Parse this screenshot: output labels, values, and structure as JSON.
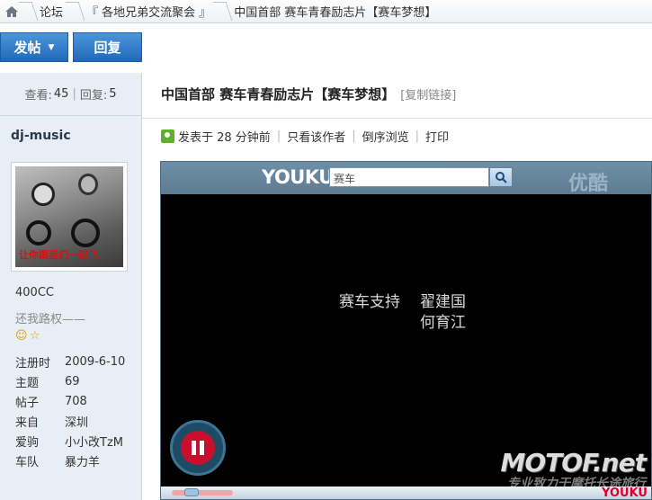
{
  "breadcrumb": {
    "items": [
      "论坛",
      "『 各地兄弟交流聚会 』",
      "中国首部 赛车青春励志片【赛车梦想】"
    ]
  },
  "actions": {
    "post": "发帖",
    "reply": "回复"
  },
  "stats": {
    "views_label": "查看:",
    "views": "45",
    "replies_label": "回复:",
    "replies": "5"
  },
  "post": {
    "title": "中国首部 赛车青春励志片【赛车梦想】",
    "copy_link": "[复制链接]",
    "posted": "发表于 28 分钟前",
    "only_author": "只看该作者",
    "reverse": "倒序浏览",
    "print": "打印"
  },
  "author": {
    "name": "dj-music",
    "avatar_caption": "让你跟我们一起飞",
    "rank": "400CC",
    "motto": "还我路权——",
    "info": [
      {
        "k": "注册时",
        "v": "2009-6-10"
      },
      {
        "k": "主题",
        "v": "69"
      },
      {
        "k": "帖子",
        "v": "708"
      },
      {
        "k": "来自",
        "v": "深圳"
      },
      {
        "k": "爱驹",
        "v": "小小改TzM"
      },
      {
        "k": "车队",
        "v": "暴力羊"
      }
    ]
  },
  "player": {
    "logo": "YOUKU",
    "search_value": "赛车",
    "brand": "优酷",
    "credits_label": "赛车支持",
    "credits_names": [
      "翟建国",
      "何育江"
    ],
    "watermark": "MOTOF.net",
    "watermark_slogan": "专业致力于摩托长途旅行",
    "corner_logo": "YOUKU"
  }
}
